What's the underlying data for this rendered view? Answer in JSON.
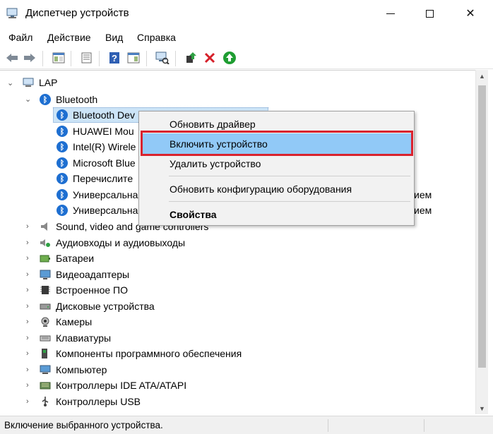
{
  "window": {
    "title": "Диспетчер устройств",
    "close_glyph": "✕"
  },
  "menu": [
    "Файл",
    "Действие",
    "Вид",
    "Справка"
  ],
  "tree": {
    "root": "LAP",
    "bluetooth": {
      "label": "Bluetooth",
      "children": [
        "Bluetooth Dev",
        "HUAWEI Mou",
        "Intel(R) Wirele",
        "Microsoft Blue",
        "Перечислите",
        "Универсальна",
        "Универсальна"
      ],
      "hidden_suffix": [
        "",
        "",
        "",
        "",
        "",
        "ием",
        "ием"
      ]
    },
    "categories": [
      {
        "label": "Sound, video and game controllers",
        "icon": "speaker-icon"
      },
      {
        "label": "Аудиовходы и аудиовыходы",
        "icon": "audio-io-icon"
      },
      {
        "label": "Батареи",
        "icon": "battery-icon"
      },
      {
        "label": "Видеоадаптеры",
        "icon": "display-adapter-icon"
      },
      {
        "label": "Встроенное ПО",
        "icon": "firmware-icon"
      },
      {
        "label": "Дисковые устройства",
        "icon": "disk-drive-icon"
      },
      {
        "label": "Камеры",
        "icon": "camera-icon"
      },
      {
        "label": "Клавиатуры",
        "icon": "keyboard-icon"
      },
      {
        "label": "Компоненты программного обеспечения",
        "icon": "software-component-icon"
      },
      {
        "label": "Компьютер",
        "icon": "computer-icon"
      },
      {
        "label": "Контроллеры IDE ATA/ATAPI",
        "icon": "ide-controller-icon"
      },
      {
        "label": "Контроллеры USB",
        "icon": "usb-controller-icon"
      }
    ]
  },
  "context_menu": {
    "items": [
      "Обновить драйвер",
      "Включить устройство",
      "Удалить устройство",
      "Обновить конфигурацию оборудования",
      "Свойства"
    ],
    "highlighted": "Включить устройство"
  },
  "status": {
    "text": "Включение выбранного устройства."
  },
  "colors": {
    "selection": "#cce4f7",
    "menu_highlight": "#91c9f7",
    "annotation_box": "#d9232e",
    "bluetooth_icon": "#1e6fd1"
  }
}
